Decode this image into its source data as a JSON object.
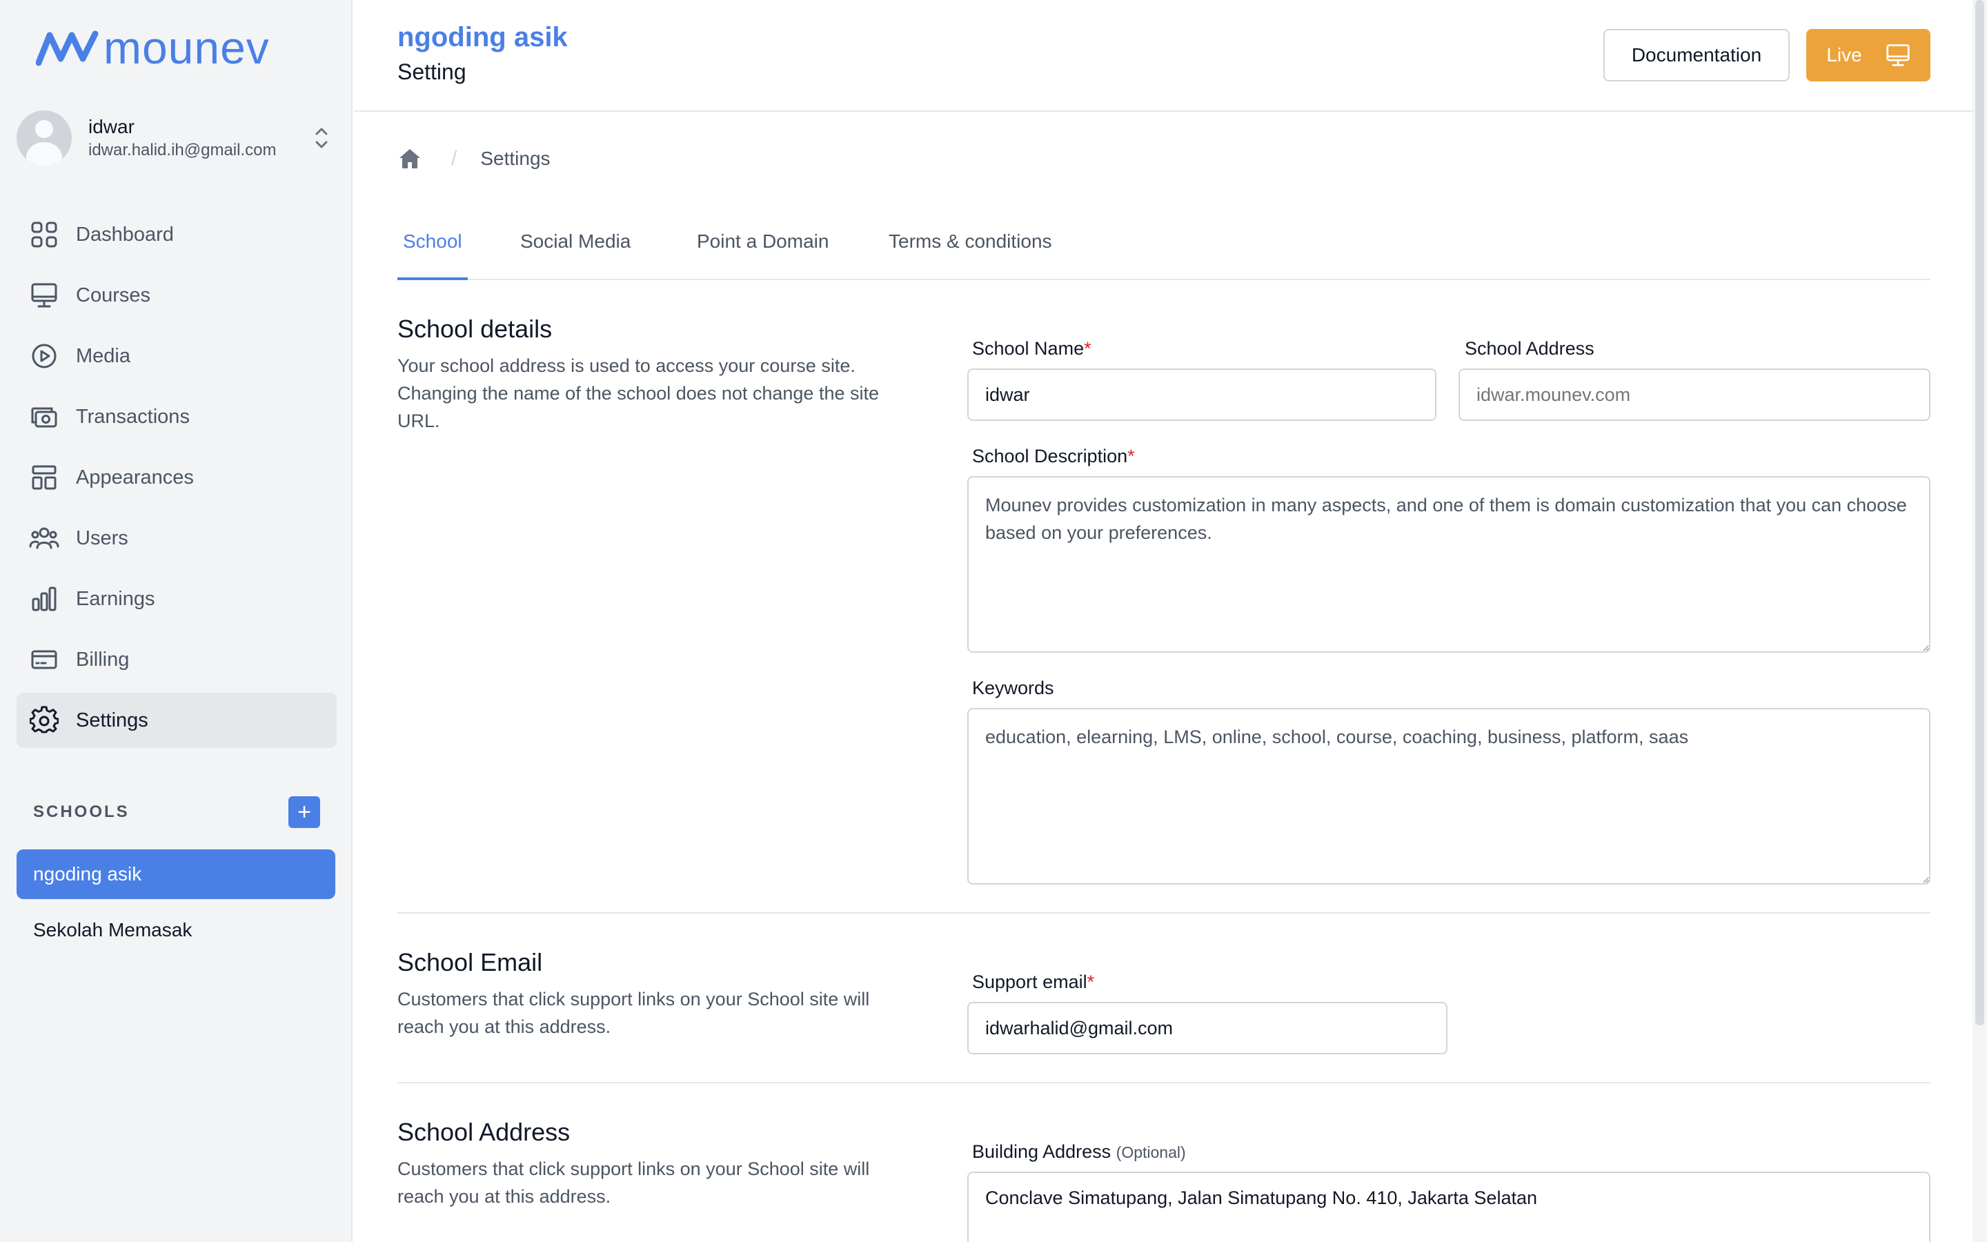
{
  "brand": {
    "name": "mounev",
    "color": "#4a7fe6"
  },
  "user": {
    "name": "idwar",
    "email": "idwar.halid.ih@gmail.com"
  },
  "nav": [
    {
      "label": "Dashboard",
      "icon": "grid-icon"
    },
    {
      "label": "Courses",
      "icon": "monitor-icon"
    },
    {
      "label": "Media",
      "icon": "play-circle-icon"
    },
    {
      "label": "Transactions",
      "icon": "cash-icon"
    },
    {
      "label": "Appearances",
      "icon": "layout-icon"
    },
    {
      "label": "Users",
      "icon": "users-icon"
    },
    {
      "label": "Earnings",
      "icon": "bar-chart-icon"
    },
    {
      "label": "Billing",
      "icon": "credit-card-icon"
    },
    {
      "label": "Settings",
      "icon": "gear-icon",
      "active": true
    }
  ],
  "schools": {
    "title": "SCHOOLS",
    "add_label": "+",
    "items": [
      {
        "label": "ngoding asik",
        "active": true
      },
      {
        "label": "Sekolah Memasak"
      }
    ]
  },
  "header": {
    "school": "ngoding asik",
    "page": "Setting",
    "doc_button": "Documentation",
    "live_button": "Live",
    "live_color": "#eda33b"
  },
  "breadcrumb": {
    "separator": "/",
    "current": "Settings"
  },
  "tabs": [
    {
      "label": "School",
      "active": true
    },
    {
      "label": "Social Media"
    },
    {
      "label": "Point a Domain"
    },
    {
      "label": "Terms & conditions"
    }
  ],
  "sections": {
    "details": {
      "title": "School details",
      "desc": "Your school address is used to access your course site. Changing the name of the school does not change the site URL.",
      "name_label": "School Name",
      "name_value": "idwar",
      "address_label": "School Address",
      "address_placeholder": "idwar.mounev.com",
      "description_label": "School Description",
      "description_value": "Mounev provides customization in many aspects, and one of them is domain customization that you can choose based on your preferences.",
      "keywords_label": "Keywords",
      "keywords_value": "education, elearning, LMS, online, school, course, coaching, business, platform, saas",
      "required_mark": "*"
    },
    "email": {
      "title": "School Email",
      "desc": "Customers that click support links on your School site will reach you at this address.",
      "support_label": "Support email",
      "support_value": "idwarhalid@gmail.com"
    },
    "address": {
      "title": "School Address",
      "desc": "Customers that click support links on your School site will reach you at this address.",
      "building_label": "Building Address",
      "building_optional": "(Optional)",
      "building_value": "Conclave Simatupang, Jalan Simatupang No. 410, Jakarta Selatan"
    }
  }
}
